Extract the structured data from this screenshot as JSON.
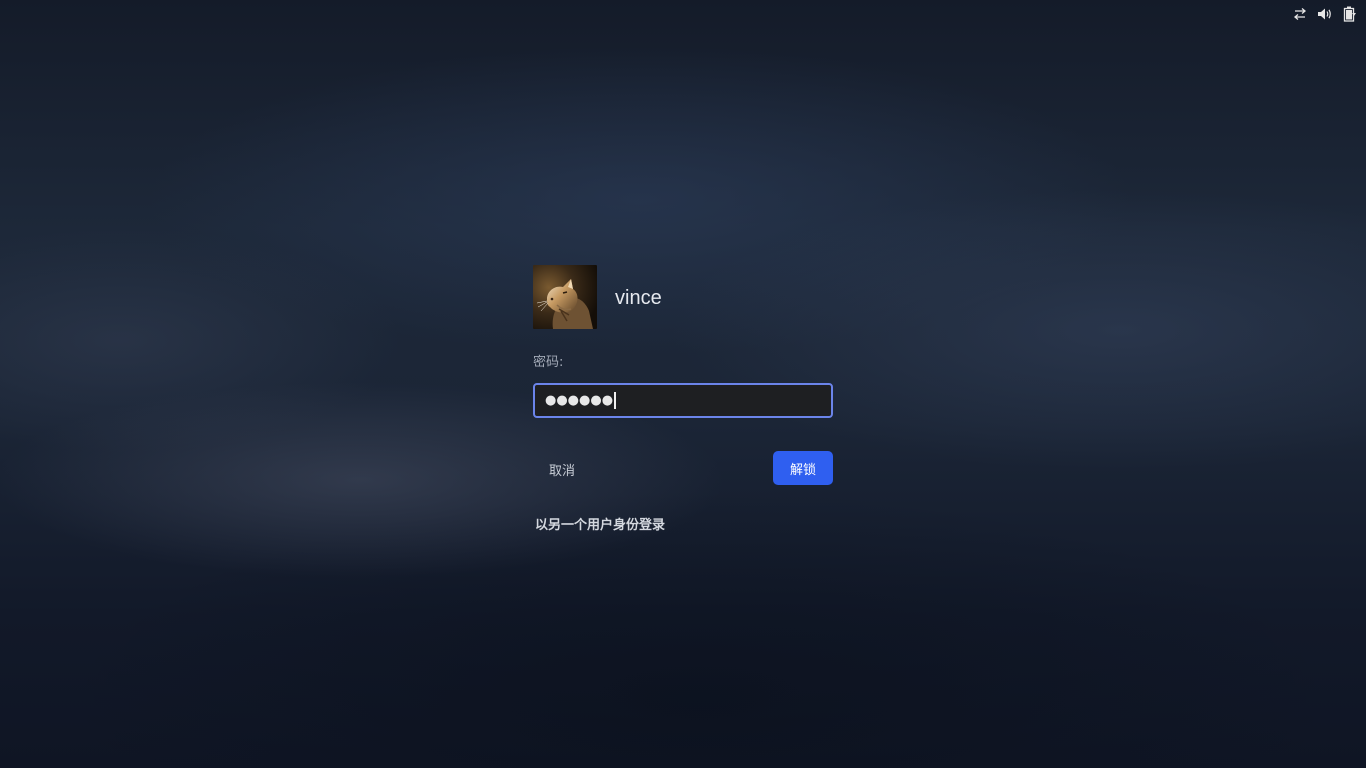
{
  "tray": {
    "icons": [
      "network-icon",
      "volume-icon",
      "battery-icon"
    ]
  },
  "login": {
    "username": "vince",
    "password_label": "密码:",
    "password_mask": "●●●●●●",
    "cancel_label": "取消",
    "unlock_label": "解锁",
    "switch_user_label": "以另一个用户身份登录"
  },
  "colors": {
    "accent": "#2f5ff0",
    "focus_border": "#6b84ea",
    "background": "#151d2d"
  }
}
